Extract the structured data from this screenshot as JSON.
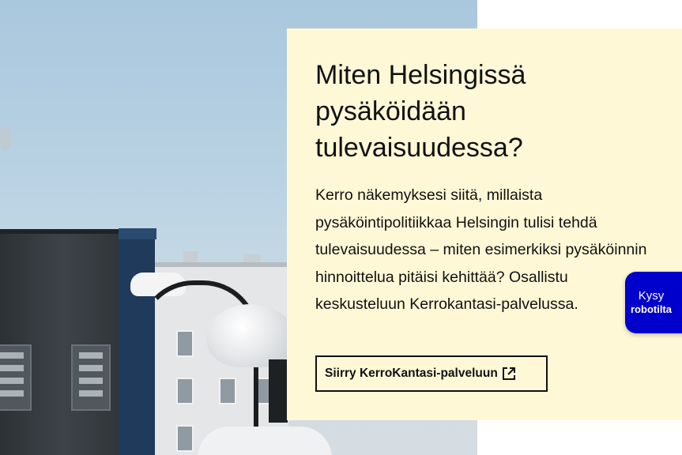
{
  "hero": {
    "image_alt": "",
    "colors": {
      "sky": "#b7d0e2",
      "charger": "#3a4045",
      "charger_accent": "#1f3a5a"
    }
  },
  "card": {
    "background_color": "#fff8d6",
    "title": "Miten Helsingissä pysäköidään tulevaisuudessa?",
    "body": "Kerro näkemyksesi siitä, millaista pysäköintipolitiikkaa Helsingin tulisi tehdä tulevaisuudessa – miten esimerkiksi pysäköinnin hinnoittelua pitäisi kehittää? Osallistu keskusteluun Kerrokantasi-palvelussa.",
    "cta": {
      "label": "Siirry KerroKantasi-palveluun",
      "icon": "external-link-icon"
    }
  },
  "chat_widget": {
    "line1": "Kysy",
    "line2": "robotilta",
    "color": "#0000cd"
  }
}
